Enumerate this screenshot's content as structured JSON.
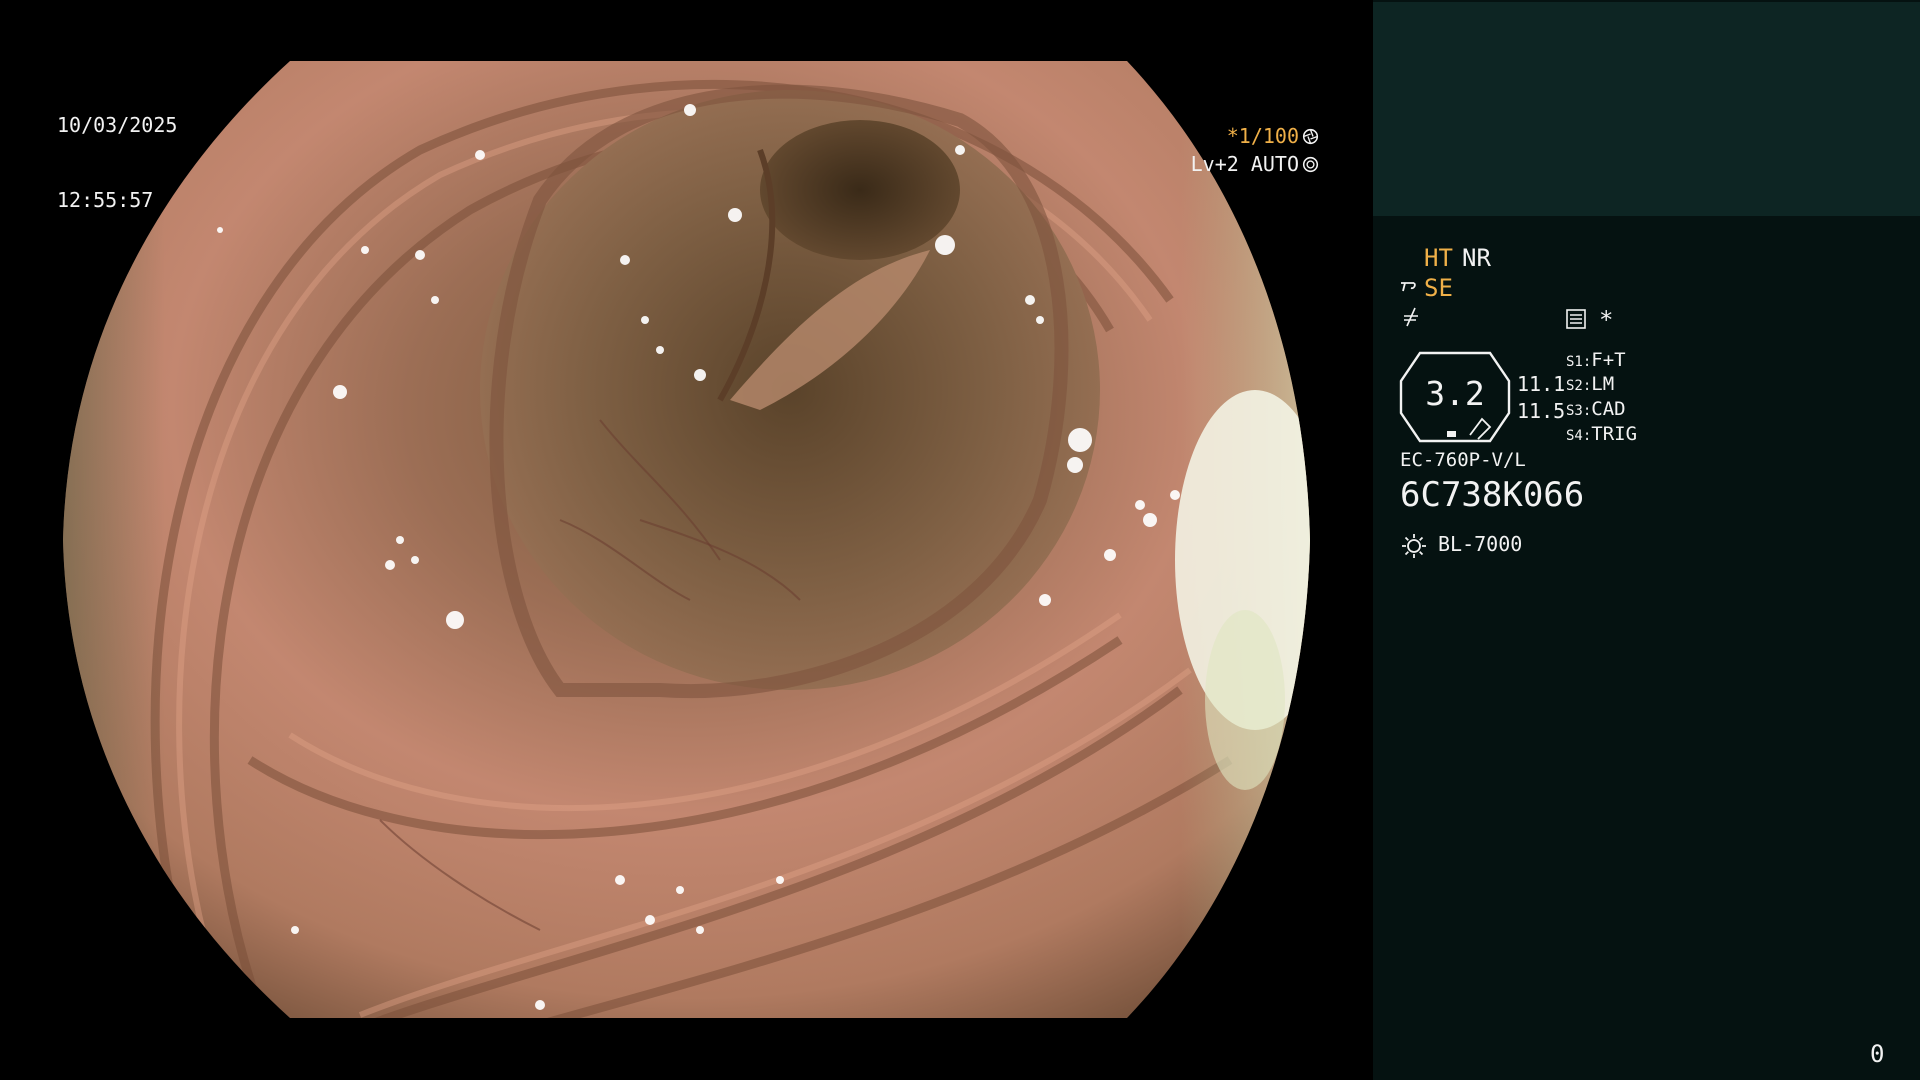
{
  "overlay": {
    "date": "10/03/2025",
    "time": "12:55:57",
    "shutter_speed": "*1/100",
    "shutter_icon": "aperture-icon",
    "level": "Lv+2",
    "exposure_mode": "AUTO",
    "exposure_icon": "iris-icon"
  },
  "panel": {
    "top_block_color": "#0d2523",
    "background_color": "#051211",
    "accent_color": "#f0b048",
    "modes": {
      "ht": "HT",
      "nr": "NR",
      "se": "SE",
      "se_icon": "structure-enhance-icon",
      "freeze_icon": "freeze-icon",
      "menu_icon": "menu-list-icon",
      "star": "*"
    },
    "zoom": {
      "value": "3.2",
      "value_a": "11.1",
      "value_b": "11.5"
    },
    "switches": [
      {
        "key": "S1:",
        "value": "F+T"
      },
      {
        "key": "S2:",
        "value": "LM"
      },
      {
        "key": "S3:",
        "value": "CAD"
      },
      {
        "key": "S4:",
        "value": "TRIG"
      }
    ],
    "scope_model": "EC-760P-V/L",
    "scope_serial": "6C738K066",
    "light_icon": "light-source-icon",
    "light_source": "BL-7000",
    "frame_counter": "0"
  }
}
